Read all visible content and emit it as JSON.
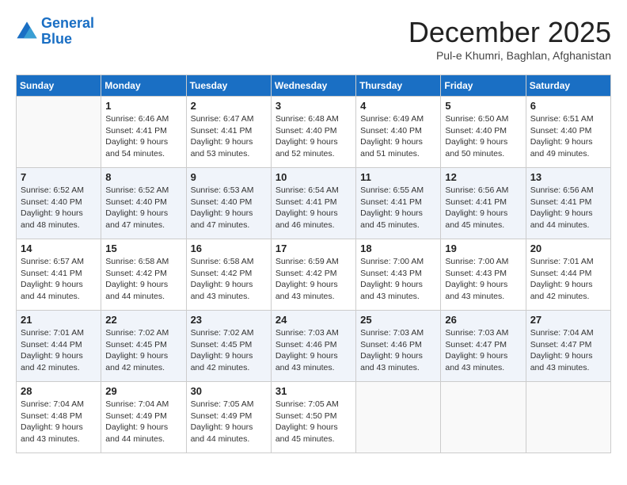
{
  "header": {
    "logo_line1": "General",
    "logo_line2": "Blue",
    "month_title": "December 2025",
    "location": "Pul-e Khumri, Baghlan, Afghanistan"
  },
  "weekdays": [
    "Sunday",
    "Monday",
    "Tuesday",
    "Wednesday",
    "Thursday",
    "Friday",
    "Saturday"
  ],
  "weeks": [
    [
      {
        "day": "",
        "info": ""
      },
      {
        "day": "1",
        "info": "Sunrise: 6:46 AM\nSunset: 4:41 PM\nDaylight: 9 hours\nand 54 minutes."
      },
      {
        "day": "2",
        "info": "Sunrise: 6:47 AM\nSunset: 4:41 PM\nDaylight: 9 hours\nand 53 minutes."
      },
      {
        "day": "3",
        "info": "Sunrise: 6:48 AM\nSunset: 4:40 PM\nDaylight: 9 hours\nand 52 minutes."
      },
      {
        "day": "4",
        "info": "Sunrise: 6:49 AM\nSunset: 4:40 PM\nDaylight: 9 hours\nand 51 minutes."
      },
      {
        "day": "5",
        "info": "Sunrise: 6:50 AM\nSunset: 4:40 PM\nDaylight: 9 hours\nand 50 minutes."
      },
      {
        "day": "6",
        "info": "Sunrise: 6:51 AM\nSunset: 4:40 PM\nDaylight: 9 hours\nand 49 minutes."
      }
    ],
    [
      {
        "day": "7",
        "info": "Sunrise: 6:52 AM\nSunset: 4:40 PM\nDaylight: 9 hours\nand 48 minutes."
      },
      {
        "day": "8",
        "info": "Sunrise: 6:52 AM\nSunset: 4:40 PM\nDaylight: 9 hours\nand 47 minutes."
      },
      {
        "day": "9",
        "info": "Sunrise: 6:53 AM\nSunset: 4:40 PM\nDaylight: 9 hours\nand 47 minutes."
      },
      {
        "day": "10",
        "info": "Sunrise: 6:54 AM\nSunset: 4:41 PM\nDaylight: 9 hours\nand 46 minutes."
      },
      {
        "day": "11",
        "info": "Sunrise: 6:55 AM\nSunset: 4:41 PM\nDaylight: 9 hours\nand 45 minutes."
      },
      {
        "day": "12",
        "info": "Sunrise: 6:56 AM\nSunset: 4:41 PM\nDaylight: 9 hours\nand 45 minutes."
      },
      {
        "day": "13",
        "info": "Sunrise: 6:56 AM\nSunset: 4:41 PM\nDaylight: 9 hours\nand 44 minutes."
      }
    ],
    [
      {
        "day": "14",
        "info": "Sunrise: 6:57 AM\nSunset: 4:41 PM\nDaylight: 9 hours\nand 44 minutes."
      },
      {
        "day": "15",
        "info": "Sunrise: 6:58 AM\nSunset: 4:42 PM\nDaylight: 9 hours\nand 44 minutes."
      },
      {
        "day": "16",
        "info": "Sunrise: 6:58 AM\nSunset: 4:42 PM\nDaylight: 9 hours\nand 43 minutes."
      },
      {
        "day": "17",
        "info": "Sunrise: 6:59 AM\nSunset: 4:42 PM\nDaylight: 9 hours\nand 43 minutes."
      },
      {
        "day": "18",
        "info": "Sunrise: 7:00 AM\nSunset: 4:43 PM\nDaylight: 9 hours\nand 43 minutes."
      },
      {
        "day": "19",
        "info": "Sunrise: 7:00 AM\nSunset: 4:43 PM\nDaylight: 9 hours\nand 43 minutes."
      },
      {
        "day": "20",
        "info": "Sunrise: 7:01 AM\nSunset: 4:44 PM\nDaylight: 9 hours\nand 42 minutes."
      }
    ],
    [
      {
        "day": "21",
        "info": "Sunrise: 7:01 AM\nSunset: 4:44 PM\nDaylight: 9 hours\nand 42 minutes."
      },
      {
        "day": "22",
        "info": "Sunrise: 7:02 AM\nSunset: 4:45 PM\nDaylight: 9 hours\nand 42 minutes."
      },
      {
        "day": "23",
        "info": "Sunrise: 7:02 AM\nSunset: 4:45 PM\nDaylight: 9 hours\nand 42 minutes."
      },
      {
        "day": "24",
        "info": "Sunrise: 7:03 AM\nSunset: 4:46 PM\nDaylight: 9 hours\nand 43 minutes."
      },
      {
        "day": "25",
        "info": "Sunrise: 7:03 AM\nSunset: 4:46 PM\nDaylight: 9 hours\nand 43 minutes."
      },
      {
        "day": "26",
        "info": "Sunrise: 7:03 AM\nSunset: 4:47 PM\nDaylight: 9 hours\nand 43 minutes."
      },
      {
        "day": "27",
        "info": "Sunrise: 7:04 AM\nSunset: 4:47 PM\nDaylight: 9 hours\nand 43 minutes."
      }
    ],
    [
      {
        "day": "28",
        "info": "Sunrise: 7:04 AM\nSunset: 4:48 PM\nDaylight: 9 hours\nand 43 minutes."
      },
      {
        "day": "29",
        "info": "Sunrise: 7:04 AM\nSunset: 4:49 PM\nDaylight: 9 hours\nand 44 minutes."
      },
      {
        "day": "30",
        "info": "Sunrise: 7:05 AM\nSunset: 4:49 PM\nDaylight: 9 hours\nand 44 minutes."
      },
      {
        "day": "31",
        "info": "Sunrise: 7:05 AM\nSunset: 4:50 PM\nDaylight: 9 hours\nand 45 minutes."
      },
      {
        "day": "",
        "info": ""
      },
      {
        "day": "",
        "info": ""
      },
      {
        "day": "",
        "info": ""
      }
    ]
  ]
}
